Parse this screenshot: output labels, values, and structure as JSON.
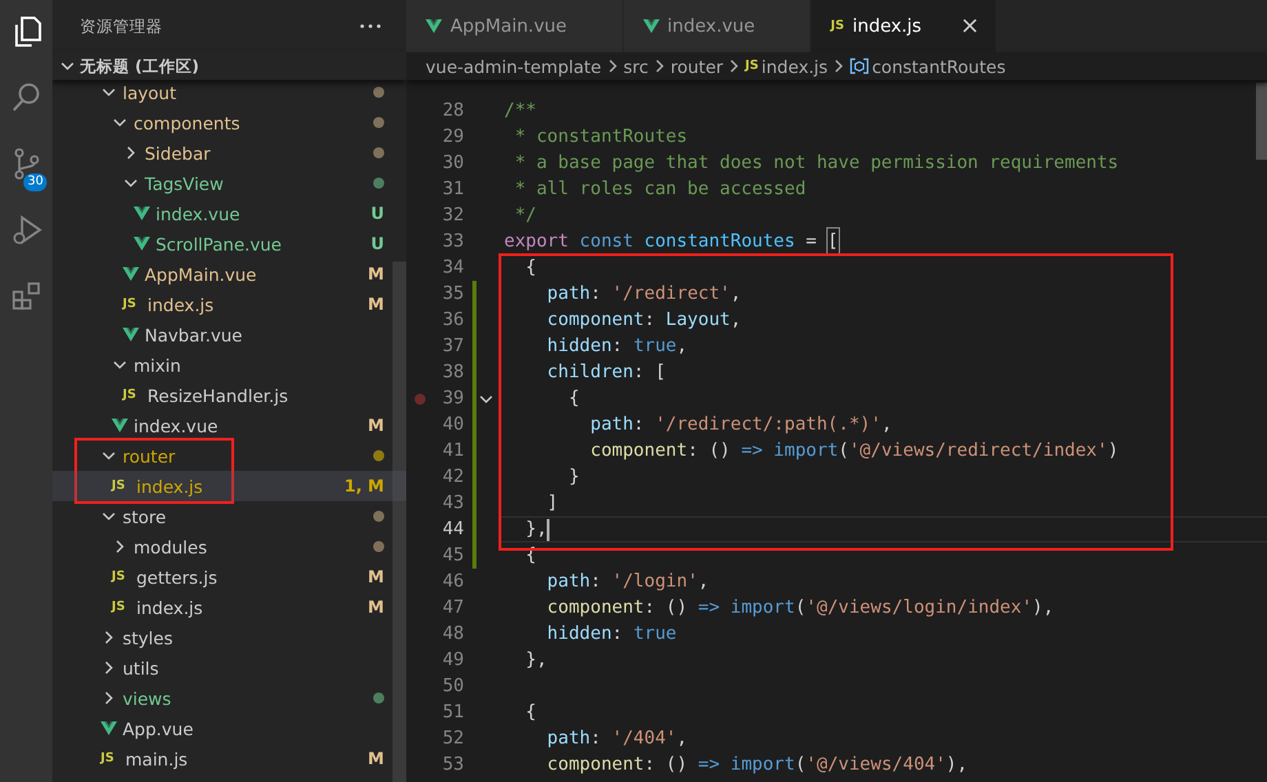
{
  "activity_bar": {
    "items": [
      {
        "kind": "files",
        "selected": true
      },
      {
        "kind": "search",
        "selected": false
      },
      {
        "kind": "source-control",
        "selected": false,
        "badge": "30"
      },
      {
        "kind": "run",
        "selected": false
      },
      {
        "kind": "extensions",
        "selected": false
      }
    ]
  },
  "explorer": {
    "title": "资源管理器",
    "workspace": {
      "label": "无标题 (工作区)",
      "expanded": true
    },
    "tree": [
      {
        "kind": "folder",
        "label": "layout",
        "expanded": true,
        "selected": false,
        "color": "#e2c08d",
        "dot": {
          "color": "#7f705a"
        },
        "children": [
          {
            "kind": "folder",
            "label": "components",
            "expanded": true,
            "selected": false,
            "color": "#e2c08d",
            "dot": {
              "color": "#7f705a"
            },
            "children": [
              {
                "kind": "folder",
                "label": "Sidebar",
                "expanded": false,
                "selected": false,
                "color": "#e2c08d",
                "dot": {
                  "color": "#7f705a"
                }
              },
              {
                "kind": "folder",
                "label": "TagsView",
                "expanded": true,
                "selected": false,
                "color": "#73c991",
                "dot": {
                  "color": "#4e7d5f"
                },
                "children": [
                  {
                    "kind": "vue",
                    "label": "index.vue",
                    "selected": false,
                    "color": "#73c991",
                    "badge": {
                      "text": "U",
                      "color": "#73c991"
                    }
                  },
                  {
                    "kind": "vue",
                    "label": "ScrollPane.vue",
                    "selected": false,
                    "color": "#73c991",
                    "badge": {
                      "text": "U",
                      "color": "#73c991"
                    }
                  }
                ]
              },
              {
                "kind": "vue",
                "label": "AppMain.vue",
                "selected": false,
                "color": "#e2c08d",
                "badge": {
                  "text": "M",
                  "color": "#e2c08d"
                }
              },
              {
                "kind": "js",
                "icon_label": "JS",
                "label": "index.js",
                "selected": false,
                "color": "#e2c08d",
                "badge": {
                  "text": "M",
                  "color": "#e2c08d"
                }
              },
              {
                "kind": "vue",
                "label": "Navbar.vue",
                "selected": false,
                "color": "#cccccc"
              }
            ]
          },
          {
            "kind": "folder",
            "label": "mixin",
            "expanded": true,
            "selected": false,
            "color": "#cccccc",
            "children": [
              {
                "kind": "js",
                "icon_label": "JS",
                "label": "ResizeHandler.js",
                "selected": false,
                "color": "#cccccc"
              }
            ]
          },
          {
            "kind": "vue",
            "label": "index.vue",
            "selected": false,
            "color": "#cccccc",
            "badge": {
              "text": "M",
              "color": "#e2c08d"
            }
          }
        ]
      },
      {
        "kind": "folder",
        "label": "router",
        "expanded": true,
        "selected": false,
        "color": "#cca700",
        "dot": {
          "color": "#8f7a12"
        },
        "children": [
          {
            "kind": "js",
            "icon_label": "JS",
            "label": "index.js",
            "selected": true,
            "color": "#cca700",
            "badge": {
              "text": "1, M",
              "color": "#cca700"
            }
          }
        ]
      },
      {
        "kind": "folder",
        "label": "store",
        "expanded": true,
        "selected": false,
        "color": "#cccccc",
        "dot": {
          "color": "#7f705a"
        },
        "children": [
          {
            "kind": "folder",
            "label": "modules",
            "expanded": false,
            "selected": false,
            "color": "#cccccc",
            "dot": {
              "color": "#7f705a"
            }
          },
          {
            "kind": "js",
            "icon_label": "JS",
            "label": "getters.js",
            "selected": false,
            "color": "#cccccc",
            "badge": {
              "text": "M",
              "color": "#e2c08d"
            }
          },
          {
            "kind": "js",
            "icon_label": "JS",
            "label": "index.js",
            "selected": false,
            "color": "#cccccc",
            "badge": {
              "text": "M",
              "color": "#e2c08d"
            }
          }
        ]
      },
      {
        "kind": "folder",
        "label": "styles",
        "expanded": false,
        "selected": false,
        "color": "#cccccc"
      },
      {
        "kind": "folder",
        "label": "utils",
        "expanded": false,
        "selected": false,
        "color": "#cccccc"
      },
      {
        "kind": "folder",
        "label": "views",
        "expanded": false,
        "selected": false,
        "color": "#73c991",
        "dot": {
          "color": "#4e7d5f"
        }
      },
      {
        "kind": "vue",
        "label": "App.vue",
        "selected": false,
        "color": "#cccccc"
      },
      {
        "kind": "js",
        "icon_label": "JS",
        "label": "main.js",
        "selected": false,
        "color": "#cccccc",
        "badge": {
          "text": "M",
          "color": "#e2c08d"
        }
      }
    ]
  },
  "editor": {
    "tabs": [
      {
        "kind": "vue",
        "label": "AppMain.vue",
        "selected": false
      },
      {
        "kind": "vue",
        "label": "index.vue",
        "selected": false
      },
      {
        "kind": "js",
        "icon_label": "JS",
        "label": "index.js",
        "selected": true,
        "close": "×"
      }
    ],
    "breadcrumb": [
      {
        "kind": "folder",
        "label": "vue-admin-template"
      },
      {
        "kind": "folder",
        "label": "src"
      },
      {
        "kind": "folder",
        "label": "router"
      },
      {
        "kind": "js",
        "icon_label": "JS",
        "label": "index.js"
      },
      {
        "kind": "symbol",
        "label": "constantRoutes"
      }
    ],
    "lines": [
      {
        "number": "28",
        "changed": false,
        "current": false,
        "breakpoint": false,
        "foldable": false,
        "tokens": [
          {
            "text": "/**",
            "kind": "comment"
          }
        ]
      },
      {
        "number": "29",
        "changed": false,
        "current": false,
        "breakpoint": false,
        "foldable": false,
        "tokens": [
          {
            "text": " * constantRoutes",
            "kind": "comment"
          }
        ]
      },
      {
        "number": "30",
        "changed": false,
        "current": false,
        "breakpoint": false,
        "foldable": false,
        "tokens": [
          {
            "text": " * a base page that does not have permission requirements",
            "kind": "comment"
          }
        ]
      },
      {
        "number": "31",
        "changed": false,
        "current": false,
        "breakpoint": false,
        "foldable": false,
        "tokens": [
          {
            "text": " * all roles can be accessed",
            "kind": "comment"
          }
        ]
      },
      {
        "number": "32",
        "changed": false,
        "current": false,
        "breakpoint": false,
        "foldable": false,
        "tokens": [
          {
            "text": " */",
            "kind": "comment"
          }
        ]
      },
      {
        "number": "33",
        "changed": false,
        "current": false,
        "breakpoint": false,
        "foldable": false,
        "tokens": [
          {
            "text": "export",
            "kind": "control"
          },
          {
            "text": " const",
            "kind": "keyword"
          },
          {
            "text": " constantRoutes",
            "kind": "constant"
          },
          {
            "text": " = ",
            "kind": "plain"
          },
          {
            "text": "[",
            "kind": "bracket-match"
          }
        ]
      },
      {
        "number": "34",
        "changed": false,
        "current": false,
        "breakpoint": false,
        "foldable": false,
        "tokens": [
          {
            "text": "  {",
            "kind": "plain"
          }
        ]
      },
      {
        "number": "35",
        "changed": true,
        "current": false,
        "breakpoint": false,
        "foldable": false,
        "tokens": [
          {
            "text": "    path",
            "kind": "property"
          },
          {
            "text": ": ",
            "kind": "plain"
          },
          {
            "text": "'/redirect'",
            "kind": "string"
          },
          {
            "text": ",",
            "kind": "plain"
          }
        ]
      },
      {
        "number": "36",
        "changed": true,
        "current": false,
        "breakpoint": false,
        "foldable": false,
        "tokens": [
          {
            "text": "    component",
            "kind": "property"
          },
          {
            "text": ": ",
            "kind": "plain"
          },
          {
            "text": "Layout",
            "kind": "property"
          },
          {
            "text": ",",
            "kind": "plain"
          }
        ]
      },
      {
        "number": "37",
        "changed": true,
        "current": false,
        "breakpoint": false,
        "foldable": false,
        "tokens": [
          {
            "text": "    hidden",
            "kind": "property"
          },
          {
            "text": ": ",
            "kind": "plain"
          },
          {
            "text": "true",
            "kind": "keyword"
          },
          {
            "text": ",",
            "kind": "plain"
          }
        ]
      },
      {
        "number": "38",
        "changed": true,
        "current": false,
        "breakpoint": false,
        "foldable": false,
        "tokens": [
          {
            "text": "    children",
            "kind": "property"
          },
          {
            "text": ": [",
            "kind": "plain"
          }
        ]
      },
      {
        "number": "39",
        "changed": true,
        "current": false,
        "breakpoint": true,
        "foldable": true,
        "tokens": [
          {
            "text": "      {",
            "kind": "plain"
          }
        ]
      },
      {
        "number": "40",
        "changed": true,
        "current": false,
        "breakpoint": false,
        "foldable": false,
        "tokens": [
          {
            "text": "        path",
            "kind": "property"
          },
          {
            "text": ": ",
            "kind": "plain"
          },
          {
            "text": "'/redirect/:path(.*)'",
            "kind": "string"
          },
          {
            "text": ",",
            "kind": "plain"
          }
        ]
      },
      {
        "number": "41",
        "changed": true,
        "current": false,
        "breakpoint": false,
        "foldable": false,
        "tokens": [
          {
            "text": "        component",
            "kind": "method"
          },
          {
            "text": ": () ",
            "kind": "plain"
          },
          {
            "text": "=>",
            "kind": "keyword"
          },
          {
            "text": " import",
            "kind": "keyword"
          },
          {
            "text": "(",
            "kind": "plain"
          },
          {
            "text": "'@/views/redirect/index'",
            "kind": "string"
          },
          {
            "text": ")",
            "kind": "plain"
          }
        ]
      },
      {
        "number": "42",
        "changed": true,
        "current": false,
        "breakpoint": false,
        "foldable": false,
        "tokens": [
          {
            "text": "      }",
            "kind": "plain"
          }
        ]
      },
      {
        "number": "43",
        "changed": true,
        "current": false,
        "breakpoint": false,
        "foldable": false,
        "tokens": [
          {
            "text": "    ]",
            "kind": "plain"
          }
        ]
      },
      {
        "number": "44",
        "changed": true,
        "current": true,
        "breakpoint": false,
        "foldable": false,
        "tokens": [
          {
            "text": "  },",
            "kind": "plain"
          }
        ]
      },
      {
        "number": "45",
        "changed": true,
        "current": false,
        "breakpoint": false,
        "foldable": false,
        "tokens": [
          {
            "text": "  {",
            "kind": "plain"
          }
        ]
      },
      {
        "number": "46",
        "changed": false,
        "current": false,
        "breakpoint": false,
        "foldable": false,
        "tokens": [
          {
            "text": "    path",
            "kind": "property"
          },
          {
            "text": ": ",
            "kind": "plain"
          },
          {
            "text": "'/login'",
            "kind": "string"
          },
          {
            "text": ",",
            "kind": "plain"
          }
        ]
      },
      {
        "number": "47",
        "changed": false,
        "current": false,
        "breakpoint": false,
        "foldable": false,
        "tokens": [
          {
            "text": "    component",
            "kind": "method"
          },
          {
            "text": ": () ",
            "kind": "plain"
          },
          {
            "text": "=>",
            "kind": "keyword"
          },
          {
            "text": " import",
            "kind": "keyword"
          },
          {
            "text": "(",
            "kind": "plain"
          },
          {
            "text": "'@/views/login/index'",
            "kind": "string"
          },
          {
            "text": "),",
            "kind": "plain"
          }
        ]
      },
      {
        "number": "48",
        "changed": false,
        "current": false,
        "breakpoint": false,
        "foldable": false,
        "tokens": [
          {
            "text": "    hidden",
            "kind": "property"
          },
          {
            "text": ": ",
            "kind": "plain"
          },
          {
            "text": "true",
            "kind": "keyword"
          }
        ]
      },
      {
        "number": "49",
        "changed": false,
        "current": false,
        "breakpoint": false,
        "foldable": false,
        "tokens": [
          {
            "text": "  },",
            "kind": "plain"
          }
        ]
      },
      {
        "number": "50",
        "changed": false,
        "current": false,
        "breakpoint": false,
        "foldable": false
      },
      {
        "number": "51",
        "changed": false,
        "current": false,
        "breakpoint": false,
        "foldable": false,
        "tokens": [
          {
            "text": "  {",
            "kind": "plain"
          }
        ]
      },
      {
        "number": "52",
        "changed": false,
        "current": false,
        "breakpoint": false,
        "foldable": false,
        "tokens": [
          {
            "text": "    path",
            "kind": "property"
          },
          {
            "text": ": ",
            "kind": "plain"
          },
          {
            "text": "'/404'",
            "kind": "string"
          },
          {
            "text": ",",
            "kind": "plain"
          }
        ]
      },
      {
        "number": "53",
        "changed": false,
        "current": false,
        "breakpoint": false,
        "foldable": false,
        "tokens": [
          {
            "text": "    component",
            "kind": "method"
          },
          {
            "text": ": () ",
            "kind": "plain"
          },
          {
            "text": "=>",
            "kind": "keyword"
          },
          {
            "text": " import",
            "kind": "keyword"
          },
          {
            "text": "(",
            "kind": "plain"
          },
          {
            "text": "'@/views/404'",
            "kind": "string"
          },
          {
            "text": "),",
            "kind": "plain"
          }
        ]
      }
    ]
  }
}
